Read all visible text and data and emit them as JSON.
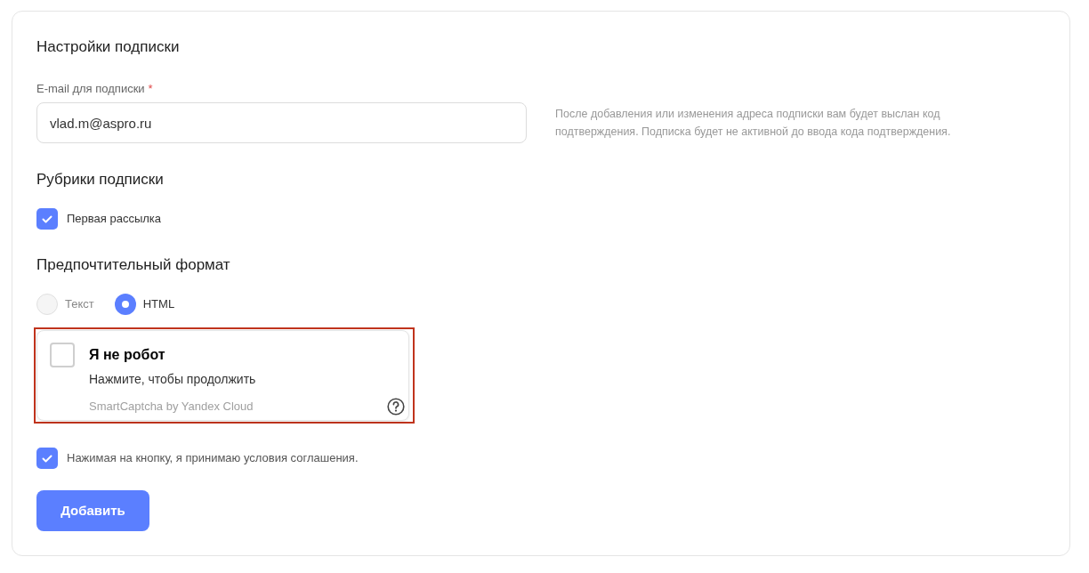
{
  "title": "Настройки подписки",
  "email": {
    "label": "E-mail для подписки",
    "required_mark": "*",
    "value": "vlad.m@aspro.ru",
    "hint": "После добавления или изменения адреса подписки вам будет выслан код подтверждения. Подписка будет не активной до ввода кода подтверждения."
  },
  "rubrics": {
    "title": "Рубрики подписки",
    "items": [
      {
        "label": "Первая рассылка",
        "checked": true
      }
    ]
  },
  "format": {
    "title": "Предпочтительный формат",
    "options": [
      {
        "label": "Текст",
        "selected": false
      },
      {
        "label": "HTML",
        "selected": true
      }
    ]
  },
  "captcha": {
    "error": true,
    "checked": false,
    "title": "Я не робот",
    "subtitle": "Нажмите, чтобы продолжить",
    "provider": "SmartCaptcha by Yandex Cloud"
  },
  "agreement": {
    "label": "Нажимая на кнопку, я принимаю условия соглашения.",
    "checked": true
  },
  "submit": {
    "label": "Добавить"
  }
}
